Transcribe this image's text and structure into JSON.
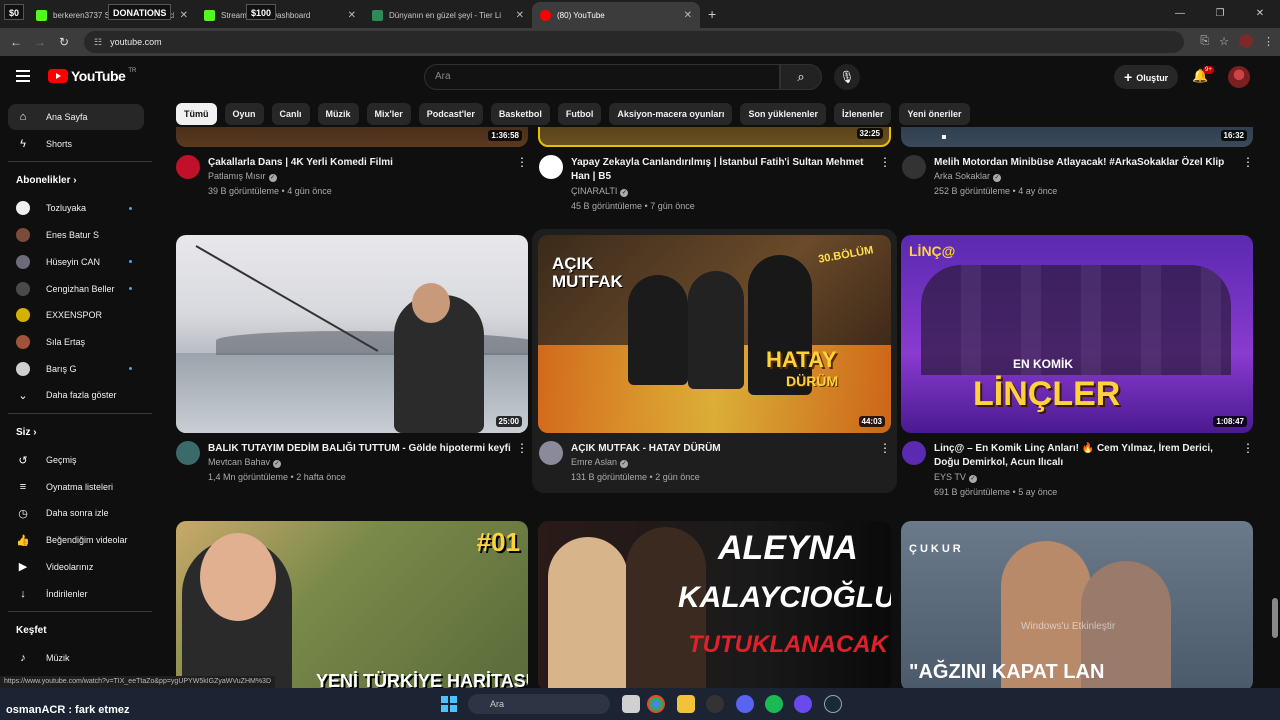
{
  "browser": {
    "tabs": [
      {
        "title": "berkeren3737 Stream Guard - Kick",
        "color": "#53fc18"
      },
      {
        "title": "Stream - Kick Dashboard",
        "color": "#53fc18"
      },
      {
        "title": "Dünyanın en güzel şeyi - Tier Li",
        "color": "#2e8b57"
      },
      {
        "title": "(80) YouTube",
        "color": "#ff0000"
      }
    ],
    "overlay": {
      "left_amount": "$0",
      "donations": "DONATIONS",
      "right_amount": "$100"
    },
    "address": "youtube.com",
    "status_url": "https://www.youtube.com/watch?v=TIX_eeTtaZo&pp=ygUPYW5kIGZyaWVuZHM%3D"
  },
  "header": {
    "logo_text": "YouTube",
    "logo_region": "TR",
    "search_placeholder": "Ara",
    "create_label": "Oluştur",
    "notif_badge": "9+"
  },
  "sidebar": {
    "main": [
      {
        "label": "Ana Sayfa",
        "icon": "home-icon",
        "glyph": "⌂"
      },
      {
        "label": "Shorts",
        "icon": "shorts-icon",
        "glyph": "ϟ"
      }
    ],
    "subs_header": "Abonelikler",
    "subs": [
      {
        "label": "Tozluyaka",
        "color": "#eeeeee",
        "dot": true
      },
      {
        "label": "Enes Batur S",
        "color": "#7a4b3a",
        "dot": false
      },
      {
        "label": "Hüseyin CAN",
        "color": "#6b6b7a",
        "dot": true
      },
      {
        "label": "Cengizhan Beller",
        "color": "#4a4a4a",
        "dot": true
      },
      {
        "label": "EXXENSPOR",
        "color": "#d4b000",
        "dot": false
      },
      {
        "label": "Sıla Ertaş",
        "color": "#a0523a",
        "dot": false
      },
      {
        "label": "Barış G",
        "color": "#cfcfcf",
        "dot": true
      }
    ],
    "show_more": "Daha fazla göster",
    "you_header": "Siz",
    "you": [
      {
        "label": "Geçmiş",
        "icon": "history-icon",
        "glyph": "↺"
      },
      {
        "label": "Oynatma listeleri",
        "icon": "playlist-icon",
        "glyph": "≡"
      },
      {
        "label": "Daha sonra izle",
        "icon": "clock-icon",
        "glyph": "◷"
      },
      {
        "label": "Beğendiğim videolar",
        "icon": "like-icon",
        "glyph": "👍"
      },
      {
        "label": "Videolarınız",
        "icon": "video-icon",
        "glyph": "▶"
      },
      {
        "label": "İndirilenler",
        "icon": "download-icon",
        "glyph": "↓"
      }
    ],
    "explore_header": "Keşfet",
    "explore": [
      {
        "label": "Müzik",
        "icon": "music-icon",
        "glyph": "♪"
      }
    ]
  },
  "chips": [
    "Tümü",
    "Oyun",
    "Canlı",
    "Müzik",
    "Mix'ler",
    "Podcast'ler",
    "Basketbol",
    "Futbol",
    "Aksiyon-macera oyunları",
    "Son yüklenenler",
    "İzlenenler",
    "Yeni öneriler"
  ],
  "videos_row1": [
    {
      "duration": "1:36:58",
      "title": "Çakallarla Dans | 4K Yerli Komedi Filmi",
      "channel": "Patlamış Mısır",
      "meta": "39 B görüntüleme • 4 gün önce",
      "avatar": "#c0102a"
    },
    {
      "duration": "32:25",
      "title": "Yapay Zekayla Canlandırılmış | İstanbul Fatih'i Sultan Mehmet Han | B5",
      "channel": "ÇINARALTI",
      "meta": "45 B görüntüleme • 7 gün önce",
      "avatar": "#2a8a3a"
    },
    {
      "duration": "16:32",
      "title": "Melih Motordan Minibüse Atlayacak! #ArkaSokaklar Özel Klip",
      "channel": "Arka Sokaklar",
      "meta": "252 B görüntüleme • 4 ay önce",
      "avatar": "#333333"
    }
  ],
  "videos_row2": [
    {
      "duration": "25:00",
      "title": "BALIK TUTAYIM DEDİM BALIĞI TUTTUM - Gölde hipotermi keyfi",
      "channel": "Mevtcan Bahav",
      "meta": "1,4 Mn görüntüleme • 2 hafta önce",
      "avatar": "#3a6a6a"
    },
    {
      "duration": "44:03",
      "title": "AÇIK MUTFAK - HATAY DÜRÜM",
      "channel": "Emre Aslan",
      "meta": "131 B görüntüleme • 2 gün önce",
      "avatar": "#8a8a9a",
      "thumb_text": [
        "AÇIK",
        "MUTFAK",
        "HATAY",
        "DÜRÜM",
        "30.BÖLÜM"
      ]
    },
    {
      "duration": "1:08:47",
      "title": "Linç@ – En Komik Linç Anları! 🔥 Cem Yılmaz, İrem Derici, Doğu Demirkol, Acun Ilıcalı",
      "channel": "EYS TV",
      "meta": "691 B görüntüleme • 5 ay önce",
      "avatar": "#5a2ab0",
      "thumb_text": [
        "LİNÇ@",
        "EN KOMİK",
        "LİNÇLER"
      ]
    }
  ],
  "videos_row3": [
    {
      "thumb_text": [
        "#01",
        "YENİ TÜRKİYE HARİTASI"
      ]
    },
    {
      "thumb_text": [
        "ALEYNA",
        "KALAYCIOĞLU",
        "TUTUKLANACAK MI?"
      ]
    },
    {
      "thumb_text": [
        "ÇUKUR",
        "\"AĞZINI KAPAT LAN",
        "Windows'u Etkinleştir"
      ]
    }
  ],
  "taskbar": {
    "user_line": "osmanACR : fark etmez",
    "search": "Ara"
  },
  "colors": {
    "bg": "#0f0f0f",
    "chip": "#272727",
    "accent_red": "#ff0000",
    "link_blue": "#3ea6ff"
  }
}
